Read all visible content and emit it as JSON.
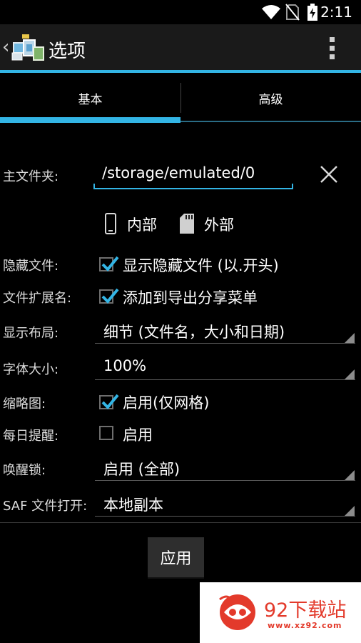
{
  "status_bar": {
    "time": "2:11",
    "icons": [
      "wifi-icon",
      "no-sim-icon",
      "battery-charging-icon"
    ]
  },
  "action_bar": {
    "title": "选项",
    "icons": [
      "back-chevron-icon",
      "app-logo-icon",
      "overflow-menu-icon"
    ]
  },
  "tabs": [
    {
      "label": "基本",
      "active": true
    },
    {
      "label": "高级",
      "active": false
    }
  ],
  "form": {
    "main_folder": {
      "label": "主文件夹:",
      "value": "/storage/emulated/0"
    },
    "storage": {
      "internal": "内部",
      "external": "外部"
    },
    "hidden_files": {
      "label": "隐藏文件:",
      "option": "显示隐藏文件 (以.开头)",
      "checked": true
    },
    "file_ext": {
      "label": "文件扩展名:",
      "option": "添加到导出分享菜单",
      "checked": true
    },
    "layout": {
      "label": "显示布局:",
      "value": "细节 (文件名，大小和日期)"
    },
    "font_size": {
      "label": "字体大小:",
      "value": "100%"
    },
    "thumbnails": {
      "label": "缩略图:",
      "option": "启用(仅网格)",
      "checked": true
    },
    "daily_reminder": {
      "label": "每日提醒:",
      "option": "启用",
      "checked": false
    },
    "wake_lock": {
      "label": "唤醒锁:",
      "value": "启用 (全部)"
    },
    "saf_open": {
      "label": "SAF 文件打开:",
      "value": "本地副本"
    }
  },
  "apply_button": "应用",
  "watermark": {
    "name": "92下载站",
    "url": "www.xz92.com"
  },
  "colors": {
    "accent": "#33b5e5",
    "watermark": "#e33a2b",
    "background": "#000000"
  }
}
